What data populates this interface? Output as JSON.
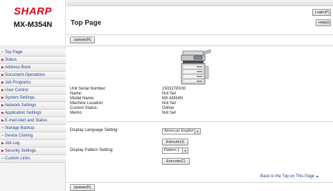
{
  "brand": {
    "logo": "SHARP",
    "model": "MX-M354N"
  },
  "header": {
    "title": "Top Page",
    "login_label": "Login(P)",
    "help_label": "Help(I)",
    "update_label": "Update(R)"
  },
  "sidebar": {
    "items": [
      {
        "label": "Top Page",
        "marker": "dash"
      },
      {
        "label": "Status",
        "marker": "arrow"
      },
      {
        "label": "Address Book",
        "marker": "arrow"
      },
      {
        "label": "Document Operations",
        "marker": "arrow"
      },
      {
        "label": "Job Programs",
        "marker": "arrow"
      },
      {
        "label": "User Control",
        "marker": "arrow"
      },
      {
        "label": "System Settings",
        "marker": "arrow"
      },
      {
        "label": "Network Settings",
        "marker": "arrow"
      },
      {
        "label": "Application Settings",
        "marker": "arrow"
      },
      {
        "label": "E-mail Alert and Status",
        "marker": "arrow"
      },
      {
        "label": "Storage Backup",
        "marker": "dash"
      },
      {
        "label": "Device Cloning",
        "marker": "dash"
      },
      {
        "label": "Job Log",
        "marker": "arrow"
      },
      {
        "label": "Security Settings",
        "marker": "arrow"
      },
      {
        "label": "Custom Links",
        "marker": "dash"
      }
    ]
  },
  "device_info": {
    "rows": [
      {
        "label": "Unit Serial Number:",
        "value": "1503278X00"
      },
      {
        "label": "Name:",
        "value": "Not Set"
      },
      {
        "label": "Model Name:",
        "value": "MX-M354N"
      },
      {
        "label": "Machine Location:",
        "value": "Not Set"
      },
      {
        "label": "Current Status:",
        "value": "Online"
      },
      {
        "label": "Memo:",
        "value": "Not Set"
      }
    ]
  },
  "language": {
    "label": "Display Language Setting:",
    "selected": "American English",
    "execute_label": "Execute(J)"
  },
  "pattern": {
    "label": "Display Pattern Setting:",
    "selected": "Pattern 1",
    "execute_label": "Execute(C)"
  },
  "footer": {
    "back_to_top": "Back to the Top on This Page"
  },
  "colors": {
    "brand_red": "#e0001b",
    "link_blue": "#1f3f8f",
    "nav_arrow": "#c8102e"
  }
}
